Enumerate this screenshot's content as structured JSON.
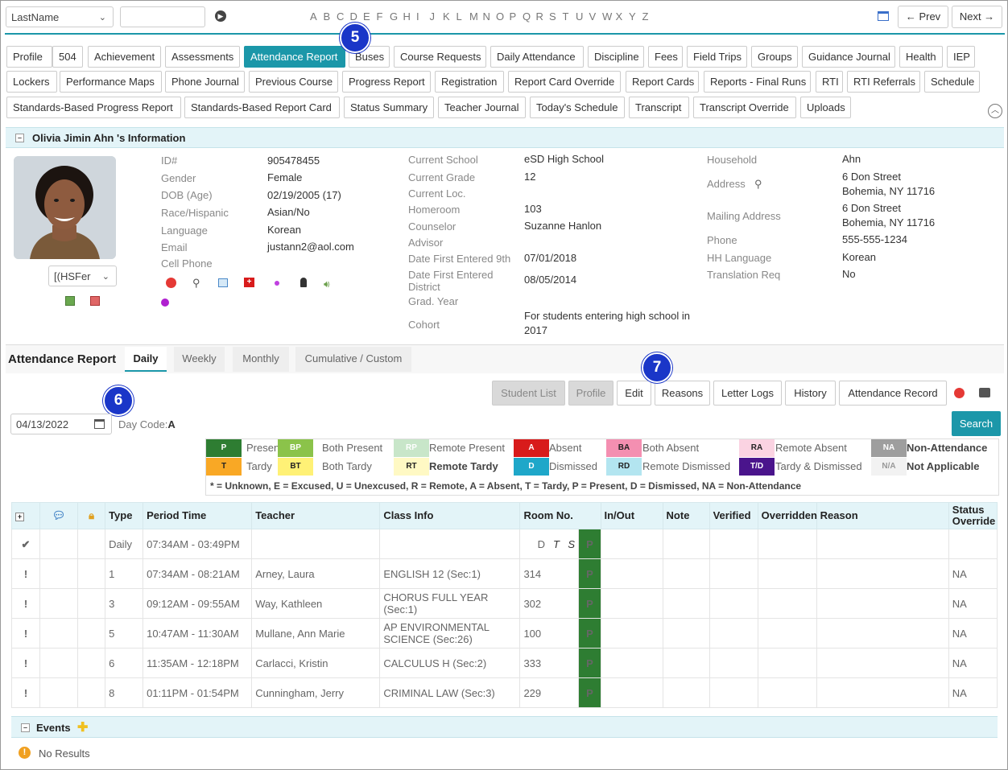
{
  "topbar": {
    "search_field": "LastName",
    "search_value": "",
    "alphabet": [
      "A",
      "B",
      "C",
      "D",
      "E",
      "F",
      "G",
      "H",
      "I",
      "J",
      "K",
      "L",
      "M",
      "N",
      "O",
      "P",
      "Q",
      "R",
      "S",
      "T",
      "U",
      "V",
      "W",
      "X",
      "Y",
      "Z"
    ],
    "prev": "← Prev",
    "next": "Next →"
  },
  "tabs": [
    "Profile",
    "504",
    "Achievement",
    "Assessments",
    "Attendance Report",
    "Buses",
    "Course Requests",
    "Daily Attendance",
    "Discipline",
    "Fees",
    "Field Trips",
    "Groups",
    "Guidance Journal",
    "Health",
    "IEP",
    "Lockers",
    "Performance Maps",
    "Phone Journal",
    "Previous Course",
    "Progress Report",
    "Registration",
    "Report Card Override",
    "Report Cards",
    "Reports - Final Runs",
    "RTI",
    "RTI Referrals",
    "Schedule",
    "Standards-Based Progress Report",
    "Standards-Based Report Card",
    "Status Summary",
    "Teacher Journal",
    "Today's Schedule",
    "Transcript",
    "Transcript Override",
    "Uploads"
  ],
  "active_tab": "Attendance Report",
  "callouts": [
    "5",
    "6",
    "7"
  ],
  "student": {
    "header": "Olivia Jimin Ahn 's Information",
    "calendar_select": "[(HSFer",
    "col1": [
      [
        "ID#",
        "905478455"
      ],
      [
        "Gender",
        "Female"
      ],
      [
        "DOB (Age)",
        "02/19/2005 (17)"
      ],
      [
        "Race/Hispanic",
        "Asian/No"
      ],
      [
        "Language",
        "Korean"
      ],
      [
        "Email",
        "justann2@aol.com"
      ],
      [
        "Cell Phone",
        ""
      ]
    ],
    "col2": [
      [
        "Current School",
        "eSD High School"
      ],
      [
        "Current Grade",
        "12"
      ],
      [
        "Current Loc.",
        ""
      ],
      [
        "Homeroom",
        "103"
      ],
      [
        "Counselor",
        "Suzanne Hanlon"
      ],
      [
        "Advisor",
        ""
      ],
      [
        "Date First Entered 9th",
        "07/01/2018"
      ],
      [
        "Date First Entered District",
        "08/05/2014"
      ],
      [
        "Grad. Year",
        ""
      ],
      [
        "Cohort",
        "For students entering high school in 2017"
      ]
    ],
    "col3": [
      [
        "Household",
        "Ahn"
      ],
      [
        "Address",
        "6 Don Street\nBohemia, NY 11716"
      ],
      [
        "Mailing Address",
        "6 Don Street\nBohemia, NY 11716"
      ],
      [
        "Phone",
        "555-555-1234"
      ],
      [
        "HH Language",
        "Korean"
      ],
      [
        "Translation Req",
        "No"
      ]
    ]
  },
  "attendance": {
    "title": "Attendance Report",
    "subtabs": [
      "Daily",
      "Weekly",
      "Monthly",
      "Cumulative / Custom"
    ],
    "buttons": [
      "Student List",
      "Profile",
      "Edit",
      "Reasons",
      "Letter Logs",
      "History",
      "Attendance Record"
    ],
    "date": "04/13/2022",
    "day_code_label": "Day Code:",
    "day_code": "A",
    "search": "Search",
    "legend": [
      {
        "code": "P",
        "label": "Present",
        "bg": "#2e7d32",
        "fg": "#fff"
      },
      {
        "code": "BP",
        "label": "Both Present",
        "bg": "#8bc34a",
        "fg": "#fff"
      },
      {
        "code": "RP",
        "label": "Remote Present",
        "bg": "#c8e6c9",
        "fg": "#fff"
      },
      {
        "code": "A",
        "label": "Absent",
        "bg": "#d81b1b",
        "fg": "#fff"
      },
      {
        "code": "BA",
        "label": "Both Absent",
        "bg": "#f48fb1",
        "fg": "#222"
      },
      {
        "code": "RA",
        "label": "Remote Absent",
        "bg": "#fbd3e2",
        "fg": "#222"
      },
      {
        "code": "NA",
        "label": "Non-Attendance",
        "bg": "#9e9e9e",
        "fg": "#fff"
      },
      {
        "code": "T",
        "label": "Tardy",
        "bg": "#f9a825",
        "fg": "#222"
      },
      {
        "code": "BT",
        "label": "Both Tardy",
        "bg": "#fff176",
        "fg": "#222"
      },
      {
        "code": "RT",
        "label": "Remote Tardy",
        "bg": "#fff9c4",
        "fg": "#222"
      },
      {
        "code": "D",
        "label": "Dismissed",
        "bg": "#1ea7c9",
        "fg": "#fff"
      },
      {
        "code": "RD",
        "label": "Remote Dismissed",
        "bg": "#b3e5f0",
        "fg": "#222"
      },
      {
        "code": "T/D",
        "label": "Tardy & Dismissed",
        "bg": "#4a148c",
        "fg": "#fff"
      },
      {
        "code": "N/A",
        "label": "Not Applicable",
        "bg": "#f2f2f2",
        "fg": "#999"
      }
    ],
    "legend_note": "* = Unknown, E = Excused, U = Unexcused, R = Remote, A = Absent, T = Tardy, P = Present, D = Dismissed, NA = Non-Attendance",
    "columns": [
      "Type",
      "Period Time",
      "Teacher",
      "Class Info",
      "Room No.",
      "In/Out",
      "Note",
      "Verified",
      "Overridden",
      "Reason",
      "Status Override"
    ],
    "daily_row": {
      "type": "Daily",
      "time": "07:34AM - 03:49PM",
      "d": "D",
      "t": "T",
      "s": "S",
      "status": "P"
    },
    "rows": [
      {
        "type": "1",
        "time": "07:34AM - 08:21AM",
        "teacher": "Arney, Laura",
        "class": "ENGLISH 12 (Sec:1)",
        "room": "314",
        "status": "P",
        "override": "NA"
      },
      {
        "type": "3",
        "time": "09:12AM - 09:55AM",
        "teacher": "Way, Kathleen",
        "class": "CHORUS FULL YEAR (Sec:1)",
        "room": "302",
        "status": "P",
        "override": "NA"
      },
      {
        "type": "5",
        "time": "10:47AM - 11:30AM",
        "teacher": "Mullane, Ann Marie",
        "class": "AP ENVIRONMENTAL SCIENCE (Sec:26)",
        "room": "100",
        "status": "P",
        "override": "NA"
      },
      {
        "type": "6",
        "time": "11:35AM - 12:18PM",
        "teacher": "Carlacci, Kristin",
        "class": "CALCULUS H (Sec:2)",
        "room": "333",
        "status": "P",
        "override": "NA"
      },
      {
        "type": "8",
        "time": "01:11PM - 01:54PM",
        "teacher": "Cunningham, Jerry",
        "class": "CRIMINAL LAW (Sec:3)",
        "room": "229",
        "status": "P",
        "override": "NA"
      }
    ],
    "events_title": "Events",
    "events_empty": "No Results"
  }
}
